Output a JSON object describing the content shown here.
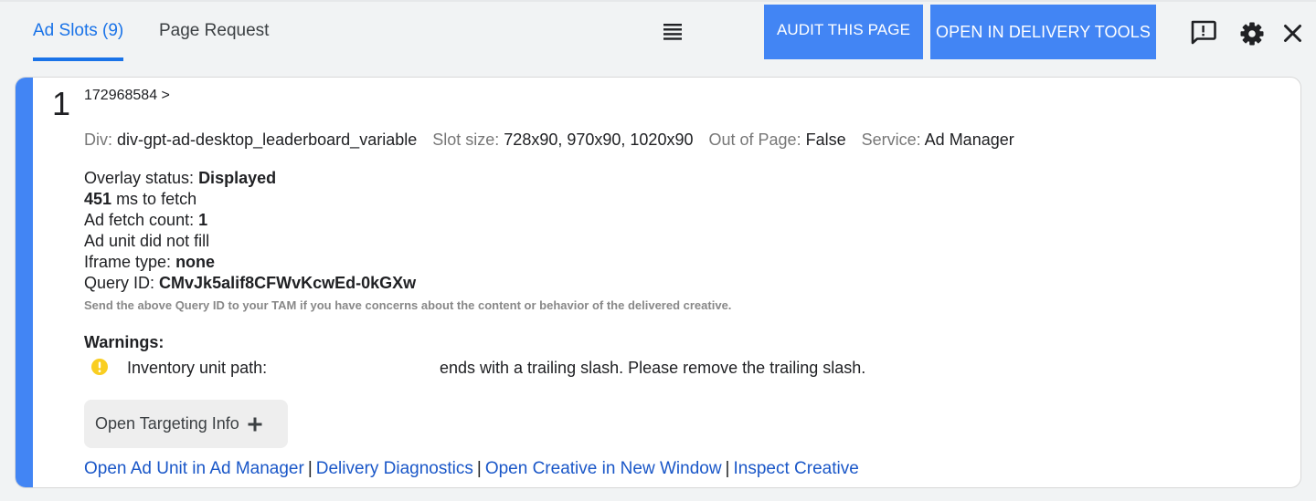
{
  "tabs": [
    {
      "label": "Ad Slots (9)",
      "active": true
    },
    {
      "label": "Page Request",
      "active": false
    }
  ],
  "toolbar": {
    "menu_icon": "list-icon",
    "audit_button": "AUDIT THIS PAGE",
    "delivery_button": "OPEN IN DELIVERY TOOLS",
    "icons": [
      "feedback-icon",
      "gear-icon",
      "close-icon"
    ],
    "accent_color": "#4285f4"
  },
  "slot": {
    "number": "1",
    "path": "172968584 >",
    "meta": {
      "div_label": "Div:",
      "div_value": "div-gpt-ad-desktop_leaderboard_variable",
      "size_label": "Slot size:",
      "size_value": "728x90, 970x90, 1020x90",
      "oop_label": "Out of Page:",
      "oop_value": "False",
      "service_label": "Service:",
      "service_value": "Ad Manager"
    },
    "overlay_label": "Overlay status:",
    "overlay_value": "Displayed",
    "fetch_ms": "451",
    "fetch_ms_label": "ms to fetch",
    "fetch_count_label": "Ad fetch count:",
    "fetch_count_value": "1",
    "fill_status": "Ad unit did not fill",
    "iframe_label": "Iframe type:",
    "iframe_value": "none",
    "query_label": "Query ID:",
    "query_value": "CMvJk5alif8CFWvKcwEd-0kGXw",
    "query_hint": "Send the above Query ID to your TAM if you have concerns about the content or behavior of the delivered creative.",
    "warnings_title": "Warnings:",
    "warning_label": "Inventory unit path:",
    "warning_text": "ends with a trailing slash. Please remove the trailing slash.",
    "warning_color": "#f9ce21",
    "targeting_button": "Open Targeting Info",
    "links": [
      "Open Ad Unit in Ad Manager",
      "Delivery Diagnostics",
      "Open Creative in New Window",
      "Inspect Creative"
    ],
    "link_separator": "|"
  }
}
